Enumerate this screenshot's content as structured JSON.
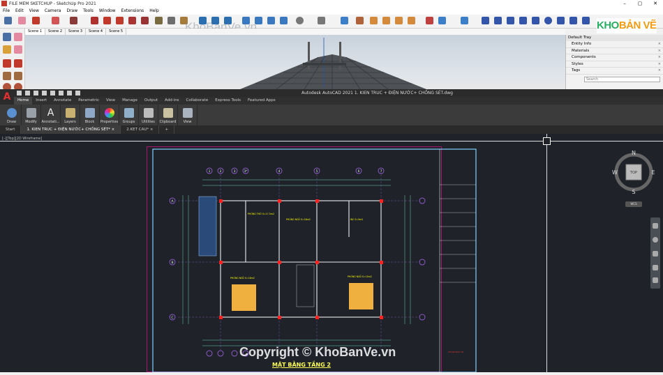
{
  "sketchup": {
    "title": "FILE MEM SKETCHUP - SketchUp Pro 2021",
    "window_buttons": [
      "–",
      "▢",
      "✕"
    ],
    "menu": [
      "File",
      "Edit",
      "View",
      "Camera",
      "Draw",
      "Tools",
      "Window",
      "Extensions",
      "Help"
    ],
    "scenes": [
      "Scene 1",
      "Scene 2",
      "Scene 3",
      "Scene 4",
      "Scene 5"
    ],
    "tray": {
      "title": "Default Tray",
      "panels": [
        "Entity Info",
        "Materials",
        "Components",
        "Styles",
        "Tags"
      ],
      "search_placeholder": "Search"
    },
    "watermark": "KhoBanVe.vn",
    "logo_text_1": "KHO",
    "logo_text_2": "BẢN VẼ"
  },
  "autocad": {
    "logo": "A",
    "title": "Autodesk AutoCAD 2021   1. KIEN TRUC + ĐIỆN NƯỚC+ CHỐNG SÉT.dwg",
    "ribbon_tabs": [
      "Home",
      "Insert",
      "Annotate",
      "Parametric",
      "View",
      "Manage",
      "Output",
      "Add-ins",
      "Collaborate",
      "Express Tools",
      "Featured Apps"
    ],
    "ribbon_buttons": [
      "Draw",
      "Modify",
      "Annotati...",
      "Layers",
      "Block",
      "Properties",
      "Groups",
      "Utilities",
      "Clipboard",
      "View"
    ],
    "doc_tabs": [
      "Start",
      "1. KIEN TRUC + ĐIỆN NƯỚC+ CHỐNG SÉT*  ×",
      "2.KET CAU*  ×",
      "+"
    ],
    "view_label": "[–][Top][2D Wireframe]",
    "viewcube": {
      "n": "N",
      "s": "S",
      "e": "E",
      "w": "W",
      "top": "TOP"
    },
    "wcs": "WCS",
    "drawing": {
      "grid_top": [
        "1",
        "2",
        "3",
        "3*",
        "4",
        "5",
        "6",
        "7"
      ],
      "grid_left": [
        "A",
        "B",
        "C"
      ],
      "rooms": [
        "PHÒNG THỜ S=17.5m2",
        "PHÒNG NGỦ S=18m2",
        "WC S=5m2",
        "PHÒNG NGỦ S=18m2",
        "PHÒNG NGỦ S=15m2"
      ],
      "title": "MẶT BẰNG TẦNG 2"
    },
    "watermark": "Copyright © KhoBanVe.vn"
  },
  "colors": {
    "autocad_bg": "#1f2329",
    "accent_red": "#e03030",
    "cad_yellow": "#ffff55"
  }
}
